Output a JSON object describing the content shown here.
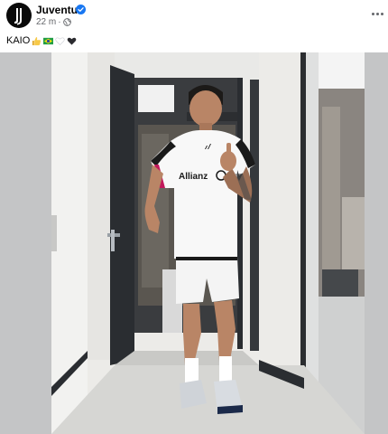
{
  "post": {
    "author": "Juventus",
    "timestamp": "22 m",
    "separator": "·",
    "caption_text": "KAIO",
    "caption_emojis": [
      "thumbs-up-emoji",
      "brazil-flag-emoji",
      "white-heart-emoji",
      "black-heart-emoji"
    ],
    "audience_icon": "globe-icon",
    "verified": true
  },
  "photo": {
    "jersey_sponsor": "Allianz",
    "jersey_brand": "adidas"
  },
  "colors": {
    "verified": "#1877f2",
    "meta_text": "#65676b",
    "media_background": "#c4c5c6",
    "avatar_background": "#0a0a0a"
  }
}
